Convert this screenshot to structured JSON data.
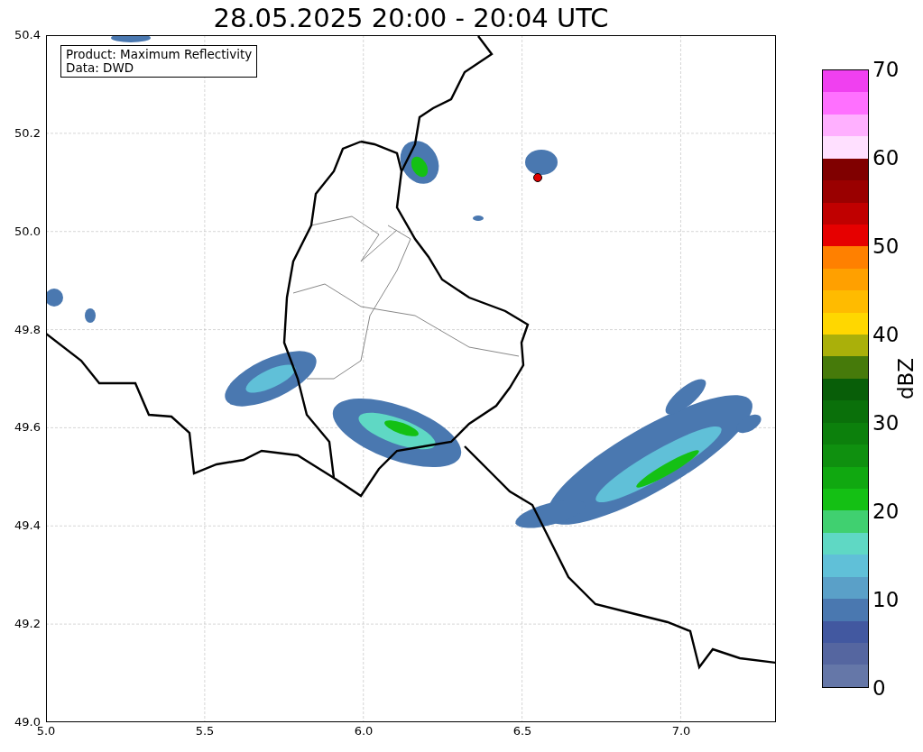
{
  "title": "28.05.2025 20:00 - 20:04 UTC",
  "info_box": [
    "Product: Maximum Reflectivity",
    "Data: DWD"
  ],
  "y_ticks": [
    "50.4",
    "50.2",
    "50.0",
    "49.8",
    "49.6",
    "49.4",
    "49.2",
    "49.0"
  ],
  "x_ticks": [
    "5.0",
    "5.5",
    "6.0",
    "6.5",
    "7.0"
  ],
  "colorbar": {
    "label": "dBZ",
    "ticks": [
      "70",
      "60",
      "50",
      "40",
      "30",
      "20",
      "10",
      "0"
    ],
    "bins": [
      {
        "color": "#f040f0"
      },
      {
        "color": "#ff70ff"
      },
      {
        "color": "#ffb0ff"
      },
      {
        "color": "#ffe0ff"
      },
      {
        "color": "#800000"
      },
      {
        "color": "#9a0000"
      },
      {
        "color": "#c00000"
      },
      {
        "color": "#e60000"
      },
      {
        "color": "#ff8000"
      },
      {
        "color": "#ffa000"
      },
      {
        "color": "#ffbb00"
      },
      {
        "color": "#ffd700"
      },
      {
        "color": "#aab00a"
      },
      {
        "color": "#467a0a"
      },
      {
        "color": "#085e08"
      },
      {
        "color": "#0a700a"
      },
      {
        "color": "#0c800c"
      },
      {
        "color": "#0f900f"
      },
      {
        "color": "#10a810"
      },
      {
        "color": "#14c014"
      },
      {
        "color": "#40d070"
      },
      {
        "color": "#5fd8c4"
      },
      {
        "color": "#60c0d8"
      },
      {
        "color": "#5aa0c8"
      },
      {
        "color": "#4a78b0"
      },
      {
        "color": "#4258a0"
      },
      {
        "color": "#5566a0"
      },
      {
        "color": "#6577a8"
      }
    ]
  }
}
